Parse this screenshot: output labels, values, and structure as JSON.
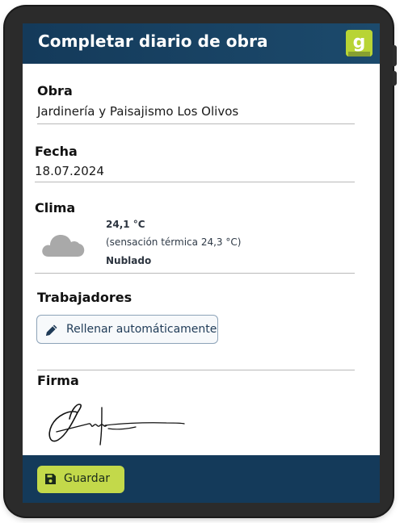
{
  "header": {
    "title": "Completar diario de obra",
    "logo_letter": "g",
    "accent_color": "#b8d435",
    "bar_color": "#143a5a"
  },
  "obra": {
    "label": "Obra",
    "value": "Jardinería y Paisajismo Los Olivos"
  },
  "fecha": {
    "label": "Fecha",
    "value": "18.07.2024"
  },
  "clima": {
    "label": "Clima",
    "icon": "cloud-icon",
    "temperature": "24,1 °C",
    "feels_like": "(sensación térmica 24,3 °C)",
    "condition": "Nublado"
  },
  "trabajadores": {
    "label": "Trabajadores",
    "autofill_label": "Rellenar automáticamente",
    "autofill_icon": "pencil-icon"
  },
  "firma": {
    "label": "Firma",
    "signature_icon": "handwritten-signature"
  },
  "footer": {
    "save_label": "Guardar",
    "save_icon": "floppy-disk-icon",
    "save_color": "#c3d94a"
  }
}
